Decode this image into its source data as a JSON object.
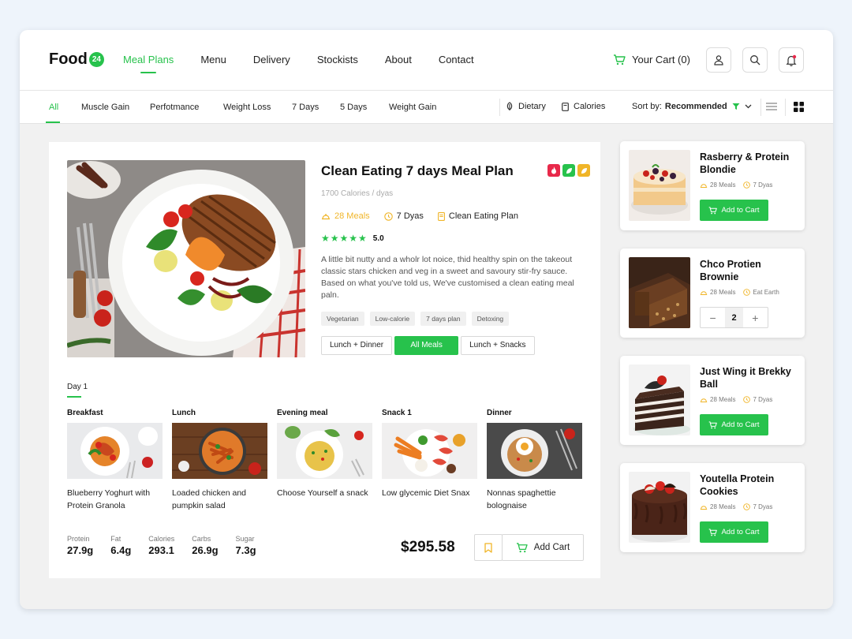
{
  "brand": {
    "name": "Food",
    "badge": "24"
  },
  "nav": {
    "links": [
      "Meal Plans",
      "Menu",
      "Delivery",
      "Stockists",
      "About",
      "Contact"
    ],
    "cart_label": "Your Cart (0)"
  },
  "filters": {
    "tabs": [
      "All",
      "Muscle Gain",
      "Perfotmance",
      "Weight Loss",
      "7 Days",
      "5 Days",
      "Weight Gain"
    ],
    "dietary": "Dietary",
    "calories": "Calories",
    "sort_prefix": "Sort by:",
    "sort_value": "Recommended"
  },
  "plan": {
    "title": "Clean Eating 7 days Meal Plan",
    "subtitle": "1700 Calories / dyas",
    "meals_count": "28 Meals",
    "days": "7 Dyas",
    "plan_name": "Clean Eating Plan",
    "rating": "5.0",
    "stars": "★★★★★",
    "description": "A little bit nutty and a wholr lot noice, thid healthy spin on the takeout classic stars chicken and veg in a sweet and savoury stir-fry sauce. Based on what you've told us, We've customised a clean eating meal paln.",
    "chips": [
      "Vegetarian",
      "Low-calorie",
      "7 days plan",
      "Detoxing"
    ],
    "meal_options": [
      "Lunch + Dinner",
      "All Meals",
      "Lunch + Snacks"
    ],
    "selected_option": "All Meals",
    "day_tab": "Day 1",
    "meals": [
      {
        "label": "Breakfast",
        "name": "Blueberry Yoghurt with Protein Granola"
      },
      {
        "label": "Lunch",
        "name": "Loaded chicken and pumpkin salad"
      },
      {
        "label": "Evening meal",
        "name": "Choose Yourself a snack"
      },
      {
        "label": "Snack 1",
        "name": "Low glycemic Diet Snax"
      },
      {
        "label": "Dinner",
        "name": "Nonnas spaghettie bolognaise"
      }
    ],
    "nutrition": [
      {
        "label": "Protein",
        "value": "27.9g"
      },
      {
        "label": "Fat",
        "value": "6.4g"
      },
      {
        "label": "Calories",
        "value": "293.1"
      },
      {
        "label": "Carbs",
        "value": "26.9g"
      },
      {
        "label": "Sugar",
        "value": "7.3g"
      }
    ],
    "price": "$295.58",
    "add_cart_label": "Add Cart"
  },
  "products": [
    {
      "name": "Rasberry & Protein Blondie",
      "meals": "28 Meals",
      "days": "7 Dyas",
      "action": "Add to Cart"
    },
    {
      "name": "Chco Protien Brownie",
      "meals": "28 Meals",
      "days": "Eat Earth",
      "quantity": "2"
    },
    {
      "name": "Just Wing it Brekky Ball",
      "meals": "28 Meals",
      "days": "7 Dyas",
      "action": "Add to Cart"
    },
    {
      "name": "Youtella Protein Cookies",
      "meals": "28 Meals",
      "days": "7 Dyas",
      "action": "Add to Cart"
    }
  ],
  "colors": {
    "accent": "#27c24c",
    "yellow": "#f0b528",
    "red": "#e8294a"
  }
}
